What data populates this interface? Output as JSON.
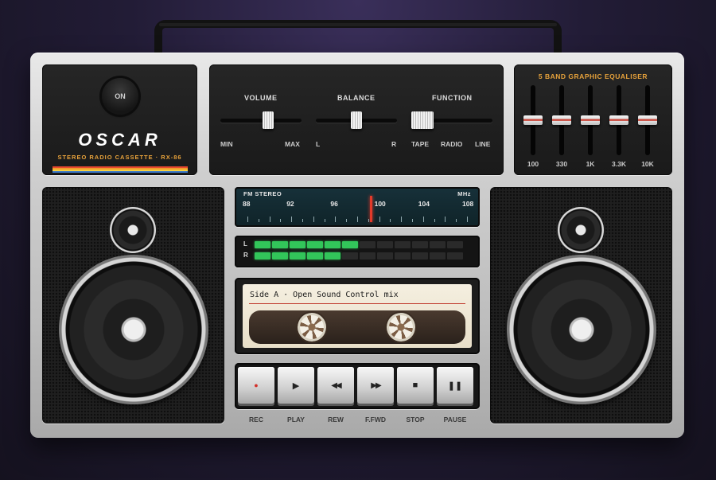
{
  "brand": {
    "power_label": "ON",
    "name": "OSCAR",
    "subtitle": "STEREO RADIO CASSETTE · RX-86",
    "stripe_colors": [
      "#e8482f",
      "#f29c2b",
      "#f5d142",
      "#3a78c9"
    ]
  },
  "controls": {
    "volume": {
      "title": "VOLUME",
      "min_label": "MIN",
      "max_label": "MAX",
      "level": 0.6
    },
    "balance": {
      "title": "BALANCE",
      "left_label": "L",
      "right_label": "R",
      "level": 0.5
    },
    "function": {
      "title": "FUNCTION",
      "options": [
        "TAPE",
        "RADIO",
        "LINE"
      ],
      "selected": "TAPE"
    }
  },
  "equalizer": {
    "title": "5 BAND GRAPHIC EQUALISER",
    "bands": [
      {
        "label": "100",
        "level": 0.5
      },
      {
        "label": "330",
        "level": 0.5
      },
      {
        "label": "1K",
        "level": 0.5
      },
      {
        "label": "3.3K",
        "level": 0.5
      },
      {
        "label": "10K",
        "level": 0.5
      }
    ]
  },
  "tuner": {
    "band_label": "FM STEREO",
    "unit_label": "MHz",
    "frequencies": [
      "88",
      "92",
      "96",
      "100",
      "104",
      "108"
    ],
    "current_frequency": 99.2
  },
  "vu_meter": {
    "channels": [
      {
        "label": "L",
        "lit": 6,
        "total": 12
      },
      {
        "label": "R",
        "lit": 5,
        "total": 12
      }
    ],
    "on_color": "#32c55a"
  },
  "cassette": {
    "label": "Side A · Open Sound Control mix"
  },
  "transport": {
    "buttons": [
      {
        "id": "rec",
        "label": "REC",
        "icon": "record-icon",
        "glyph": "●",
        "color": "#d3302a"
      },
      {
        "id": "play",
        "label": "PLAY",
        "icon": "play-icon",
        "glyph": "▶",
        "color": "#222222"
      },
      {
        "id": "rew",
        "label": "REW",
        "icon": "rewind-icon",
        "glyph": "◀◀",
        "color": "#222222"
      },
      {
        "id": "ffwd",
        "label": "F.FWD",
        "icon": "fast-forward-icon",
        "glyph": "▶▶",
        "color": "#222222"
      },
      {
        "id": "stop",
        "label": "STOP",
        "icon": "stop-icon",
        "glyph": "■",
        "color": "#222222"
      },
      {
        "id": "pause",
        "label": "PAUSE",
        "icon": "pause-icon",
        "glyph": "❚❚",
        "color": "#222222"
      }
    ]
  }
}
